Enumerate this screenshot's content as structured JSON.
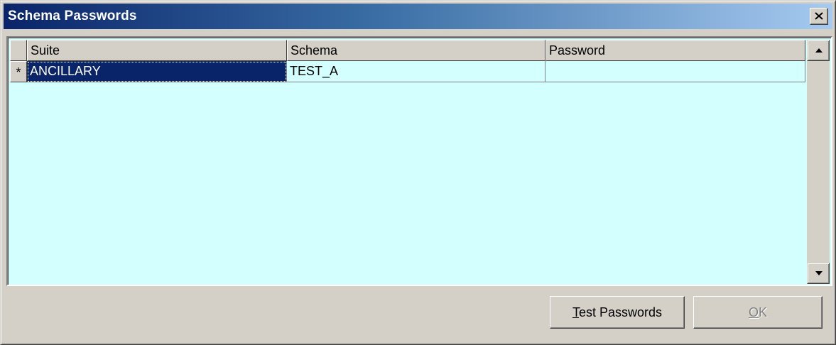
{
  "window": {
    "title": "Schema Passwords"
  },
  "grid": {
    "columns": [
      "Suite",
      "Schema",
      "Password"
    ],
    "rows": [
      {
        "indicator": "*",
        "suite": "ANCILLARY",
        "schema": "TEST_A",
        "password": ""
      }
    ]
  },
  "buttons": {
    "test_passwords": {
      "mnemonic": "T",
      "rest": "est Passwords"
    },
    "ok": {
      "mnemonic": "O",
      "rest": "K"
    }
  },
  "colors": {
    "grid_background": "#d4ffff",
    "selection": "#0a246a",
    "titlebar_start": "#0a246a",
    "titlebar_end": "#a6caf0"
  }
}
